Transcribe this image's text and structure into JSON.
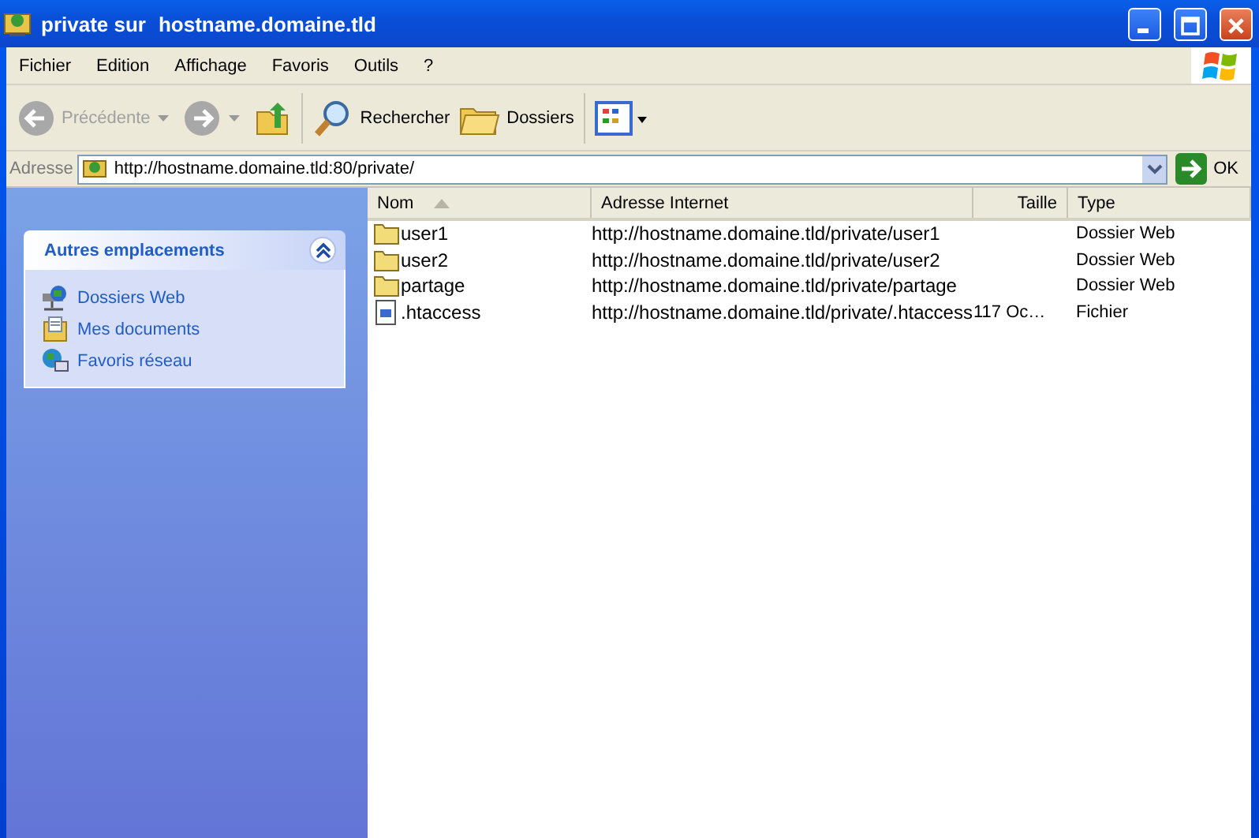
{
  "window": {
    "title_prefix": "private sur",
    "title_host": "hostname.domaine.tld"
  },
  "menu": [
    "Fichier",
    "Edition",
    "Affichage",
    "Favoris",
    "Outils",
    "?"
  ],
  "toolbar": {
    "back": {
      "label": "Précédente",
      "disabled": true
    },
    "forward": {
      "disabled": true
    },
    "search": "Rechercher",
    "folders": "Dossiers"
  },
  "address": {
    "label": "Adresse",
    "value": "http://hostname.domaine.tld:80/private/",
    "go": "OK"
  },
  "sidebar": {
    "title": "Autres emplacements",
    "expanded": true,
    "items": [
      {
        "label": "Dossiers Web",
        "kind": "webfolders"
      },
      {
        "label": "Mes documents",
        "kind": "documents"
      },
      {
        "label": "Favoris réseau",
        "kind": "network"
      }
    ]
  },
  "table": {
    "columns": [
      "Nom",
      "Adresse Internet",
      "Taille",
      "Type"
    ],
    "rows": [
      {
        "kind": "folder",
        "name": "user1",
        "url": "http://hostname.domaine.tld/private/user1",
        "size": "",
        "type": "Dossier Web"
      },
      {
        "kind": "folder",
        "name": "user2",
        "url": "http://hostname.domaine.tld/private/user2",
        "size": "",
        "type": "Dossier Web"
      },
      {
        "kind": "folder",
        "name": "partage",
        "url": "http://hostname.domaine.tld/private/partage",
        "size": "",
        "type": "Dossier Web"
      },
      {
        "kind": "file",
        "name": ".htaccess",
        "url": "http://hostname.domaine.tld/private/.htaccess",
        "size": "117 Oc…",
        "type": "Fichier"
      }
    ]
  }
}
